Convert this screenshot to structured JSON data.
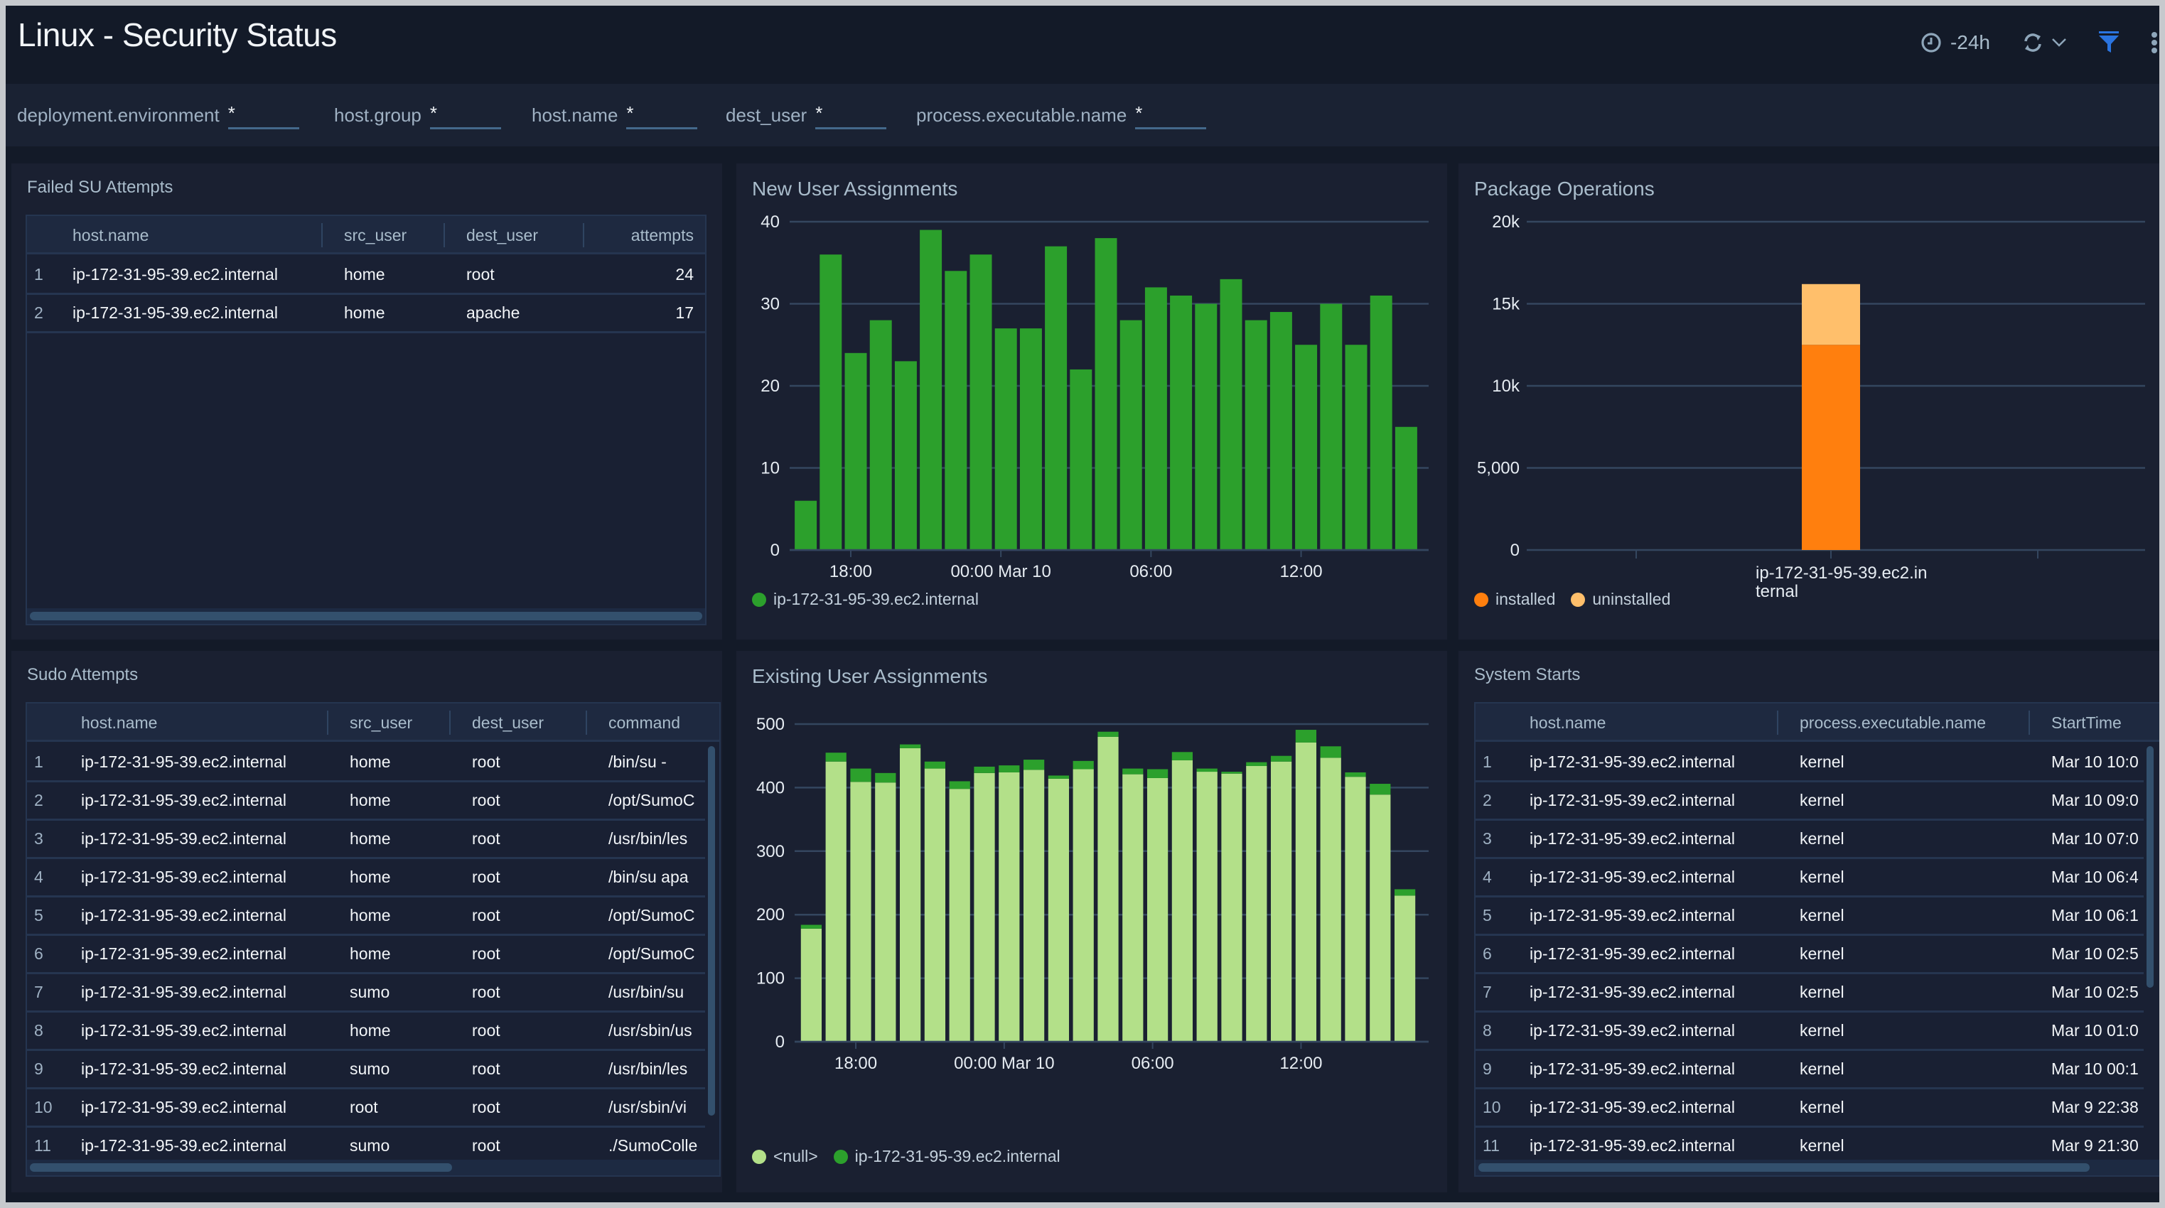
{
  "header": {
    "title": "Linux - Security Status",
    "time_range": "-24h",
    "icons": [
      "clock-icon",
      "refresh-icon",
      "chevron-down-icon",
      "filter-icon",
      "more-vertical-icon"
    ]
  },
  "filters": [
    {
      "label": "deployment.environment",
      "value": "*"
    },
    {
      "label": "host.group",
      "value": "*"
    },
    {
      "label": "host.name",
      "value": "*"
    },
    {
      "label": "dest_user",
      "value": "*"
    },
    {
      "label": "process.executable.name",
      "value": "*"
    }
  ],
  "panels": {
    "failed_su": {
      "title": "Failed SU Attempts",
      "columns": [
        "host.name",
        "src_user",
        "dest_user",
        "attempts"
      ],
      "rows": [
        {
          "idx": "1",
          "host": "ip-172-31-95-39.ec2.internal",
          "src_user": "home",
          "dest_user": "root",
          "attempts": "24"
        },
        {
          "idx": "2",
          "host": "ip-172-31-95-39.ec2.internal",
          "src_user": "home",
          "dest_user": "apache",
          "attempts": "17"
        }
      ]
    },
    "sudo": {
      "title": "Sudo Attempts",
      "columns": [
        "host.name",
        "src_user",
        "dest_user",
        "command"
      ],
      "rows": [
        {
          "idx": "1",
          "host": "ip-172-31-95-39.ec2.internal",
          "src_user": "home",
          "dest_user": "root",
          "command": "/bin/su -"
        },
        {
          "idx": "2",
          "host": "ip-172-31-95-39.ec2.internal",
          "src_user": "home",
          "dest_user": "root",
          "command": "/opt/SumoC"
        },
        {
          "idx": "3",
          "host": "ip-172-31-95-39.ec2.internal",
          "src_user": "home",
          "dest_user": "root",
          "command": "/usr/bin/les"
        },
        {
          "idx": "4",
          "host": "ip-172-31-95-39.ec2.internal",
          "src_user": "home",
          "dest_user": "root",
          "command": "/bin/su apa"
        },
        {
          "idx": "5",
          "host": "ip-172-31-95-39.ec2.internal",
          "src_user": "home",
          "dest_user": "root",
          "command": "/opt/SumoC"
        },
        {
          "idx": "6",
          "host": "ip-172-31-95-39.ec2.internal",
          "src_user": "home",
          "dest_user": "root",
          "command": "/opt/SumoC"
        },
        {
          "idx": "7",
          "host": "ip-172-31-95-39.ec2.internal",
          "src_user": "sumo",
          "dest_user": "root",
          "command": "/usr/bin/su"
        },
        {
          "idx": "8",
          "host": "ip-172-31-95-39.ec2.internal",
          "src_user": "home",
          "dest_user": "root",
          "command": "/usr/sbin/us"
        },
        {
          "idx": "9",
          "host": "ip-172-31-95-39.ec2.internal",
          "src_user": "sumo",
          "dest_user": "root",
          "command": "/usr/bin/les"
        },
        {
          "idx": "10",
          "host": "ip-172-31-95-39.ec2.internal",
          "src_user": "root",
          "dest_user": "root",
          "command": "/usr/sbin/vi"
        },
        {
          "idx": "11",
          "host": "ip-172-31-95-39.ec2.internal",
          "src_user": "sumo",
          "dest_user": "root",
          "command": "./SumoColle"
        }
      ]
    },
    "system_starts": {
      "title": "System Starts",
      "columns": [
        "host.name",
        "process.executable.name",
        "StartTime"
      ],
      "rows": [
        {
          "idx": "1",
          "host": "ip-172-31-95-39.ec2.internal",
          "process": "kernel",
          "start": "Mar 10 10:0"
        },
        {
          "idx": "2",
          "host": "ip-172-31-95-39.ec2.internal",
          "process": "kernel",
          "start": "Mar 10 09:0"
        },
        {
          "idx": "3",
          "host": "ip-172-31-95-39.ec2.internal",
          "process": "kernel",
          "start": "Mar 10 07:0"
        },
        {
          "idx": "4",
          "host": "ip-172-31-95-39.ec2.internal",
          "process": "kernel",
          "start": "Mar 10 06:4"
        },
        {
          "idx": "5",
          "host": "ip-172-31-95-39.ec2.internal",
          "process": "kernel",
          "start": "Mar 10 06:1"
        },
        {
          "idx": "6",
          "host": "ip-172-31-95-39.ec2.internal",
          "process": "kernel",
          "start": "Mar 10 02:5"
        },
        {
          "idx": "7",
          "host": "ip-172-31-95-39.ec2.internal",
          "process": "kernel",
          "start": "Mar 10 02:5"
        },
        {
          "idx": "8",
          "host": "ip-172-31-95-39.ec2.internal",
          "process": "kernel",
          "start": "Mar 10 01:0"
        },
        {
          "idx": "9",
          "host": "ip-172-31-95-39.ec2.internal",
          "process": "kernel",
          "start": "Mar 10 00:1"
        },
        {
          "idx": "10",
          "host": "ip-172-31-95-39.ec2.internal",
          "process": "kernel",
          "start": "Mar 9 22:38"
        },
        {
          "idx": "11",
          "host": "ip-172-31-95-39.ec2.internal",
          "process": "kernel",
          "start": "Mar 9 21:30"
        }
      ]
    }
  },
  "chart_data": [
    {
      "id": "new_user",
      "type": "bar",
      "title": "New User Assignments",
      "xlabel": "",
      "ylabel": "",
      "ylim": [
        0,
        40
      ],
      "yticks": [
        "0",
        "10",
        "20",
        "30",
        "40"
      ],
      "yticks_values": [
        0,
        10,
        20,
        30,
        40
      ],
      "xticks": [
        {
          "label": "18:00",
          "at": 2.3
        },
        {
          "label": "00:00 Mar 10",
          "at": 8.3
        },
        {
          "label": "06:00",
          "at": 14.3
        },
        {
          "label": "12:00",
          "at": 20.3
        }
      ],
      "grid": true,
      "legend_position": "bottom-left",
      "series": [
        {
          "name": "ip-172-31-95-39.ec2.internal",
          "color": "#2ca02c",
          "values": [
            6,
            36,
            24,
            28,
            23,
            39,
            34,
            36,
            27,
            27,
            37,
            22,
            38,
            28,
            32,
            31,
            30,
            33,
            28,
            29,
            25,
            30,
            25,
            31,
            15
          ]
        }
      ]
    },
    {
      "id": "package_ops",
      "type": "bar",
      "stacked": true,
      "title": "Package Operations",
      "xlabel": "",
      "ylabel": "",
      "ylim": [
        0,
        20000
      ],
      "yticks": [
        "0",
        "5,000",
        "10k",
        "15k",
        "20k"
      ],
      "yticks_values": [
        0,
        5000,
        10000,
        15000,
        20000
      ],
      "categories": [
        "ip-172-31-95-39.ec2.internal"
      ],
      "category_label_lines": [
        "ip-172-31-95-39.ec2.in",
        "ternal"
      ],
      "grid": true,
      "legend_position": "bottom-left",
      "series": [
        {
          "name": "installed",
          "color": "#ff7f0e",
          "values": [
            12500
          ]
        },
        {
          "name": "uninstalled",
          "color": "#ffbf6b",
          "values": [
            3700
          ]
        }
      ]
    },
    {
      "id": "existing_user",
      "type": "bar",
      "stacked": true,
      "title": "Existing User Assignments",
      "xlabel": "",
      "ylabel": "",
      "ylim": [
        0,
        500
      ],
      "yticks": [
        "0",
        "100",
        "200",
        "300",
        "400",
        "500"
      ],
      "yticks_values": [
        0,
        100,
        200,
        300,
        400,
        500
      ],
      "xticks": [
        {
          "label": "18:00",
          "at": 2.3
        },
        {
          "label": "00:00 Mar 10",
          "at": 8.3
        },
        {
          "label": "06:00",
          "at": 14.3
        },
        {
          "label": "12:00",
          "at": 20.3
        }
      ],
      "grid": true,
      "legend_position": "bottom-left",
      "series": [
        {
          "name": "<null>",
          "color": "#b3e089",
          "values": [
            178,
            441,
            409,
            408,
            462,
            430,
            398,
            423,
            424,
            428,
            414,
            429,
            480,
            421,
            415,
            443,
            425,
            422,
            434,
            441,
            471,
            447,
            417,
            389,
            230
          ]
        },
        {
          "name": "ip-172-31-95-39.ec2.internal",
          "color": "#2ca02c",
          "values": [
            6,
            14,
            21,
            15,
            6,
            11,
            12,
            10,
            11,
            16,
            5,
            13,
            8,
            9,
            14,
            13,
            5,
            3,
            6,
            9,
            20,
            18,
            7,
            17,
            10
          ]
        }
      ]
    }
  ]
}
